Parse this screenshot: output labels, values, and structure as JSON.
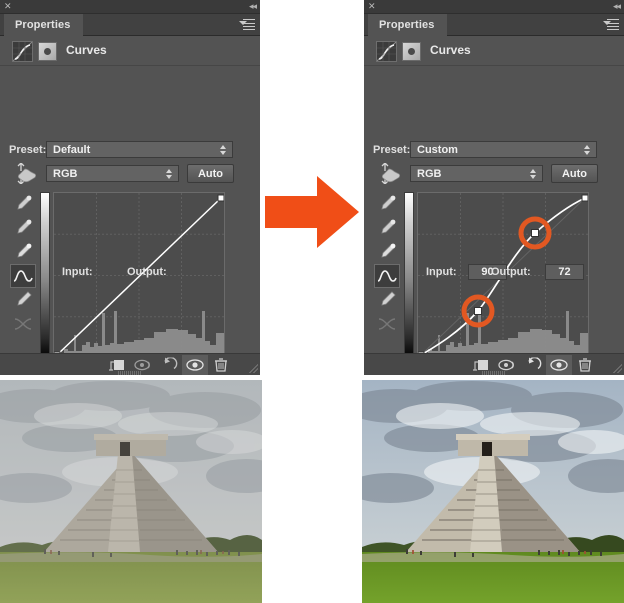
{
  "panels": [
    {
      "id": "before",
      "titlebar": {
        "close_icon": "close-icon",
        "collapse_icon": "collapse-panel-icon"
      },
      "tab_label": "Properties",
      "menu_icon": "panel-menu-icon",
      "adjustment_title": "Curves",
      "curve_glyph_icon": "curves-adjustment-icon",
      "mask_icon": "layer-mask-thumbnail",
      "preset_label": "Preset:",
      "preset_value": "Default",
      "channel_value": "RGB",
      "auto_label": "Auto",
      "hand_icon": "targeted-adjustment-hand-icon",
      "tools": [
        {
          "name": "black-point-eyedropper-icon",
          "active": false
        },
        {
          "name": "gray-point-eyedropper-icon",
          "active": false
        },
        {
          "name": "white-point-eyedropper-icon",
          "active": false
        },
        {
          "name": "edit-curve-points-icon",
          "active": true
        },
        {
          "name": "pencil-draw-curve-icon",
          "active": false
        },
        {
          "name": "smooth-curve-icon",
          "active": false
        }
      ],
      "input_label": "Input:",
      "output_label": "Output:",
      "input_value": "",
      "output_value": "",
      "show_io_boxes": false,
      "footer_icons": [
        "clip-to-layer-icon",
        "toggle-previous-state-icon",
        "reset-adjustment-icon",
        "toggle-layer-visibility-icon",
        "delete-adjustment-layer-icon"
      ]
    },
    {
      "id": "after",
      "titlebar": {
        "close_icon": "close-icon",
        "collapse_icon": "collapse-panel-icon"
      },
      "tab_label": "Properties",
      "menu_icon": "panel-menu-icon",
      "adjustment_title": "Curves",
      "curve_glyph_icon": "curves-adjustment-icon",
      "mask_icon": "layer-mask-thumbnail",
      "preset_label": "Preset:",
      "preset_value": "Custom",
      "channel_value": "RGB",
      "auto_label": "Auto",
      "hand_icon": "targeted-adjustment-hand-icon",
      "tools": [
        {
          "name": "black-point-eyedropper-icon",
          "active": false
        },
        {
          "name": "gray-point-eyedropper-icon",
          "active": false
        },
        {
          "name": "white-point-eyedropper-icon",
          "active": false
        },
        {
          "name": "edit-curve-points-icon",
          "active": true
        },
        {
          "name": "pencil-draw-curve-icon",
          "active": false
        },
        {
          "name": "smooth-curve-icon",
          "active": false
        }
      ],
      "input_label": "Input:",
      "output_label": "Output:",
      "input_value": "90",
      "output_value": "72",
      "show_io_boxes": true,
      "footer_icons": [
        "clip-to-layer-icon",
        "toggle-previous-state-icon",
        "reset-adjustment-icon",
        "toggle-layer-visibility-icon",
        "delete-adjustment-layer-icon"
      ]
    }
  ],
  "arrow": {
    "name": "transition-arrow-right",
    "color": "#F04E17"
  },
  "colors": {
    "panel_bg": "#535353",
    "titlebar_bg": "#3a3a3a",
    "graph_bg": "#4C4C4C",
    "accent_orange": "#F04E17",
    "curve_line": "#FFFFFF",
    "text": "#E3E3E3"
  },
  "chart_data": [
    {
      "type": "line",
      "id": "curves-before",
      "title": "Curves - Default (linear)",
      "xlabel": "Input",
      "ylabel": "Output",
      "xlim": [
        0,
        255
      ],
      "ylim": [
        0,
        255
      ],
      "grid": true,
      "grid_divisions": 4,
      "series": [
        {
          "name": "RGB curve",
          "x": [
            0,
            255
          ],
          "y": [
            0,
            255
          ],
          "control_points": [
            {
              "input": 0,
              "output": 0
            },
            {
              "input": 255,
              "output": 255
            }
          ]
        }
      ],
      "highlighted_points": []
    },
    {
      "type": "line",
      "id": "curves-after",
      "title": "Curves - Custom (S-curve contrast)",
      "xlabel": "Input",
      "ylabel": "Output",
      "xlim": [
        0,
        255
      ],
      "ylim": [
        0,
        255
      ],
      "grid": true,
      "grid_divisions": 4,
      "series": [
        {
          "name": "RGB curve",
          "x": [
            0,
            90,
            175,
            255
          ],
          "y": [
            0,
            72,
            200,
            255
          ],
          "control_points": [
            {
              "input": 0,
              "output": 0
            },
            {
              "input": 90,
              "output": 72
            },
            {
              "input": 175,
              "output": 200
            },
            {
              "input": 255,
              "output": 255
            }
          ]
        }
      ],
      "highlighted_points": [
        {
          "input": 90,
          "output": 72,
          "ring_color": "#E25822"
        },
        {
          "input": 175,
          "output": 200,
          "ring_color": "#E25822"
        }
      ]
    }
  ],
  "photos": [
    {
      "name": "photo-before",
      "caption": "",
      "treatment": "flat-low-contrast"
    },
    {
      "name": "photo-after",
      "caption": "",
      "treatment": "contrast-boosted"
    }
  ]
}
